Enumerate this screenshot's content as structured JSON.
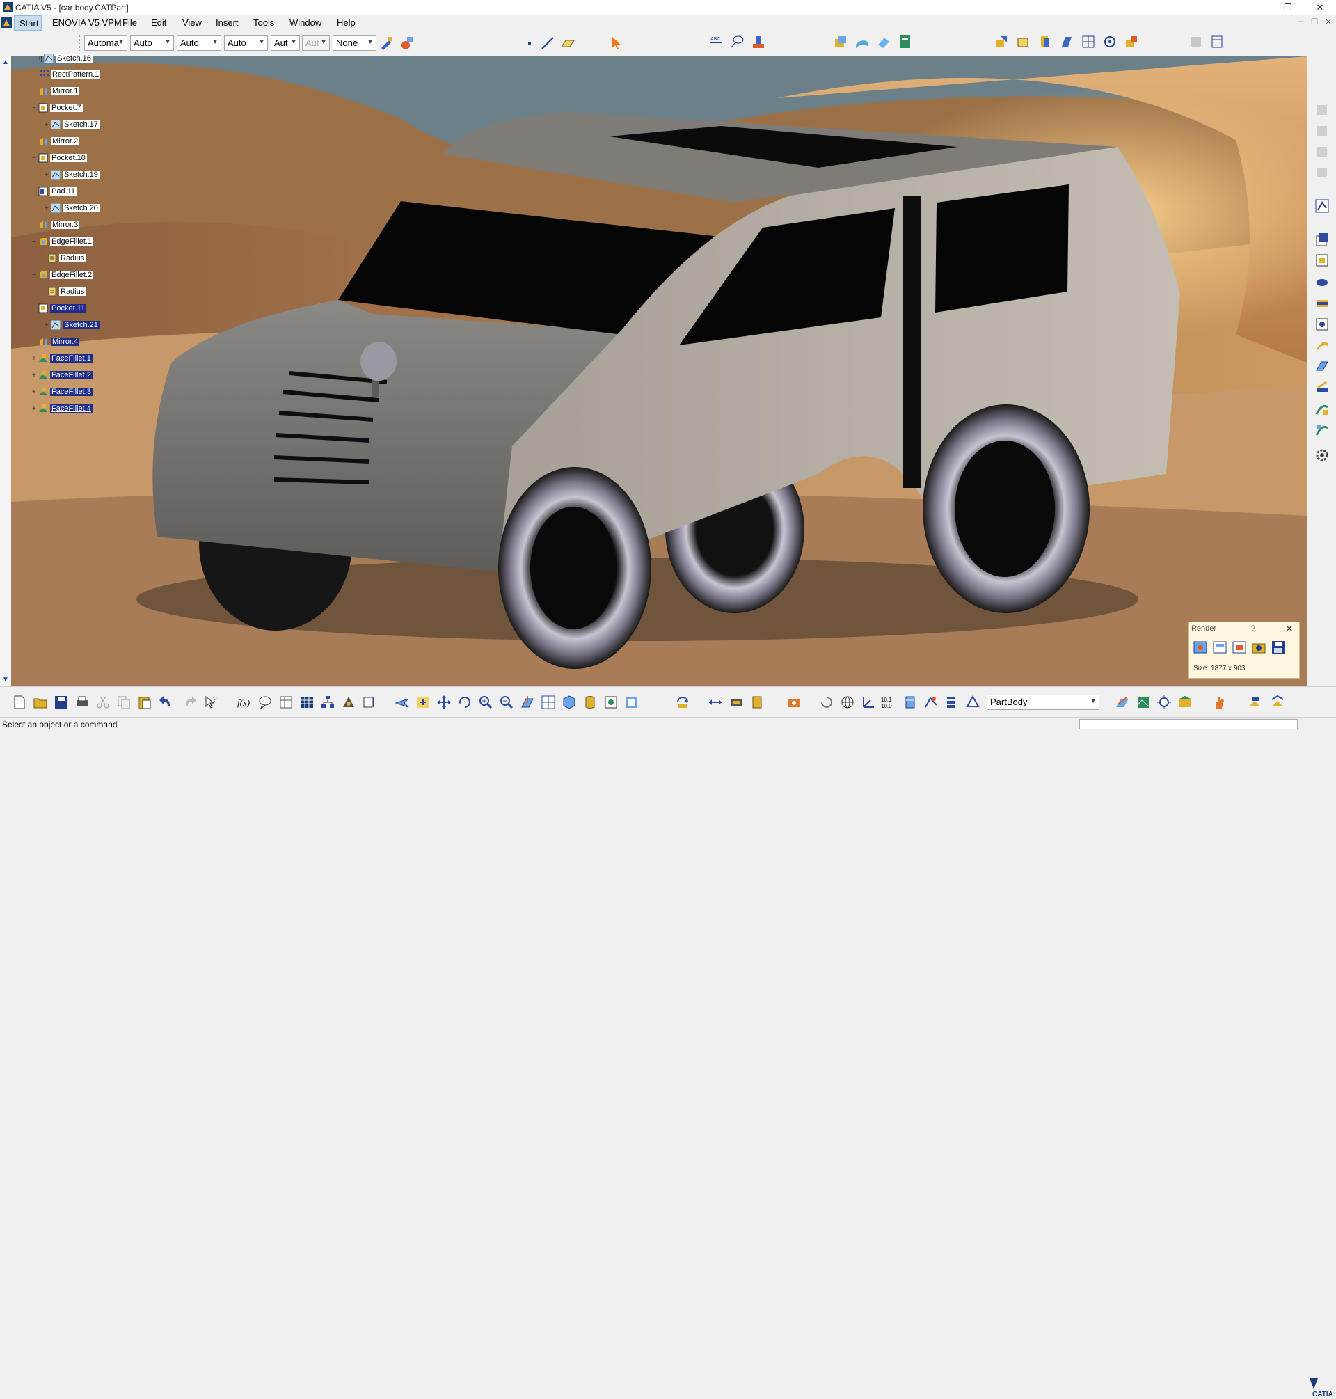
{
  "window": {
    "title": "CATIA V5 - [car body.CATPart]",
    "min": "–",
    "restore": "❐",
    "close": "✕"
  },
  "menu": {
    "items": [
      "Start",
      "ENOVIA V5 VPM",
      "File",
      "Edit",
      "View",
      "Insert",
      "Tools",
      "Window",
      "Help"
    ],
    "mdi_min": "–",
    "mdi_restore": "❐",
    "mdi_close": "✕"
  },
  "toolbar": {
    "combos": [
      "Automa",
      "Auto",
      "Auto",
      "Auto",
      "Aut",
      "Aut",
      "None"
    ]
  },
  "tree": {
    "items": [
      {
        "label": "Sketch.16",
        "type": "sketch",
        "selected": false
      },
      {
        "label": "RectPattern.1",
        "type": "pattern",
        "selected": false
      },
      {
        "label": "Mirror.1",
        "type": "mirror",
        "selected": false
      },
      {
        "label": "Pocket.7",
        "type": "pocket",
        "selected": false
      },
      {
        "label": "Sketch.17",
        "type": "sketch",
        "selected": false
      },
      {
        "label": "Mirror.2",
        "type": "mirror",
        "selected": false
      },
      {
        "label": "Pocket.10",
        "type": "pocket",
        "selected": false
      },
      {
        "label": "Sketch.19",
        "type": "sketch",
        "selected": false
      },
      {
        "label": "Pad.11",
        "type": "pad",
        "selected": false
      },
      {
        "label": "Sketch.20",
        "type": "sketch",
        "selected": false
      },
      {
        "label": "Mirror.3",
        "type": "mirror",
        "selected": false
      },
      {
        "label": "EdgeFillet.1",
        "type": "fillet",
        "selected": false
      },
      {
        "label": "Radius",
        "type": "param",
        "selected": false
      },
      {
        "label": "EdgeFillet.2",
        "type": "fillet",
        "selected": false
      },
      {
        "label": "Radius",
        "type": "param",
        "selected": false
      },
      {
        "label": "Pocket.11",
        "type": "pocket",
        "selected": true
      },
      {
        "label": "Sketch.21",
        "type": "sketch",
        "selected": true
      },
      {
        "label": "Mirror.4",
        "type": "mirror",
        "selected": true
      },
      {
        "label": "FaceFillet.1",
        "type": "facefillet",
        "selected": true
      },
      {
        "label": "FaceFillet.2",
        "type": "facefillet",
        "selected": true
      },
      {
        "label": "FaceFillet.3",
        "type": "facefillet",
        "selected": true
      },
      {
        "label": "FaceFillet.4",
        "type": "facefillet",
        "selected": true
      }
    ]
  },
  "render_panel": {
    "title": "Render",
    "help": "?",
    "close": "✕",
    "size": "Size: 1877 x 903"
  },
  "bottom": {
    "body_select": "PartBody"
  },
  "status": {
    "message": "Select an object or a command"
  },
  "colors": {
    "selection": "#1e2e8a",
    "menu_highlight": "#c7def2",
    "render_panel": "#fff7df",
    "car_body": "#b5aea5",
    "car_hood": "#7e7c79"
  }
}
